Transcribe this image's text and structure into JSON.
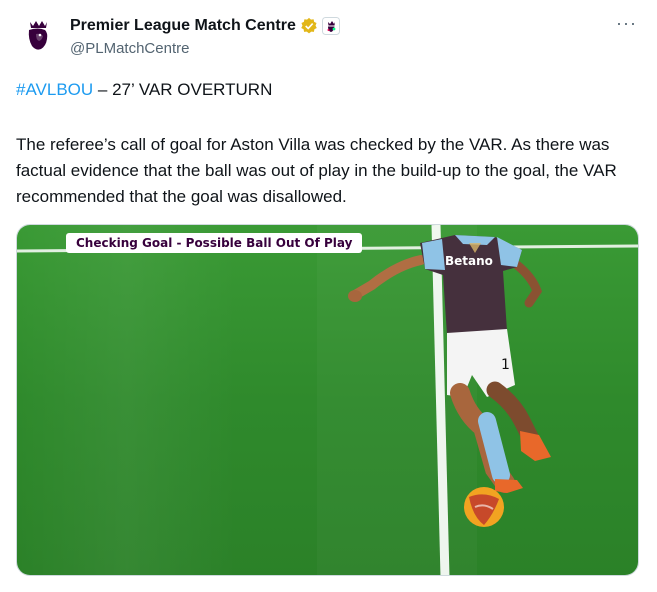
{
  "tweet": {
    "display_name": "Premier League Match Centre",
    "handle": "@PLMatchCentre",
    "more_label": "···",
    "hashtag": "#AVLBOU",
    "headline_rest": " – 27’ VAR OVERTURN",
    "body": "The referee’s call of goal for Aston Villa was checked by the VAR. As there was factual evidence that the ball was out of play in the build-up to the goal, the VAR recommended that the goal was disallowed."
  },
  "media": {
    "overlay_label": "Checking Goal - Possible Ball Out Of Play",
    "shirt_sponsor": "Betano",
    "shirt_number": "1"
  },
  "icons": {
    "avatar": "premier-league-lion-icon",
    "verified": "gold-verified-badge-icon",
    "affiliate": "affiliate-badge-icon",
    "more": "more-options-icon"
  },
  "colors": {
    "hashtag": "#1d9bf0",
    "verified_gold": "#e2b719",
    "pl_purple": "#37003c",
    "pitch_green": "#2f8a2c"
  }
}
